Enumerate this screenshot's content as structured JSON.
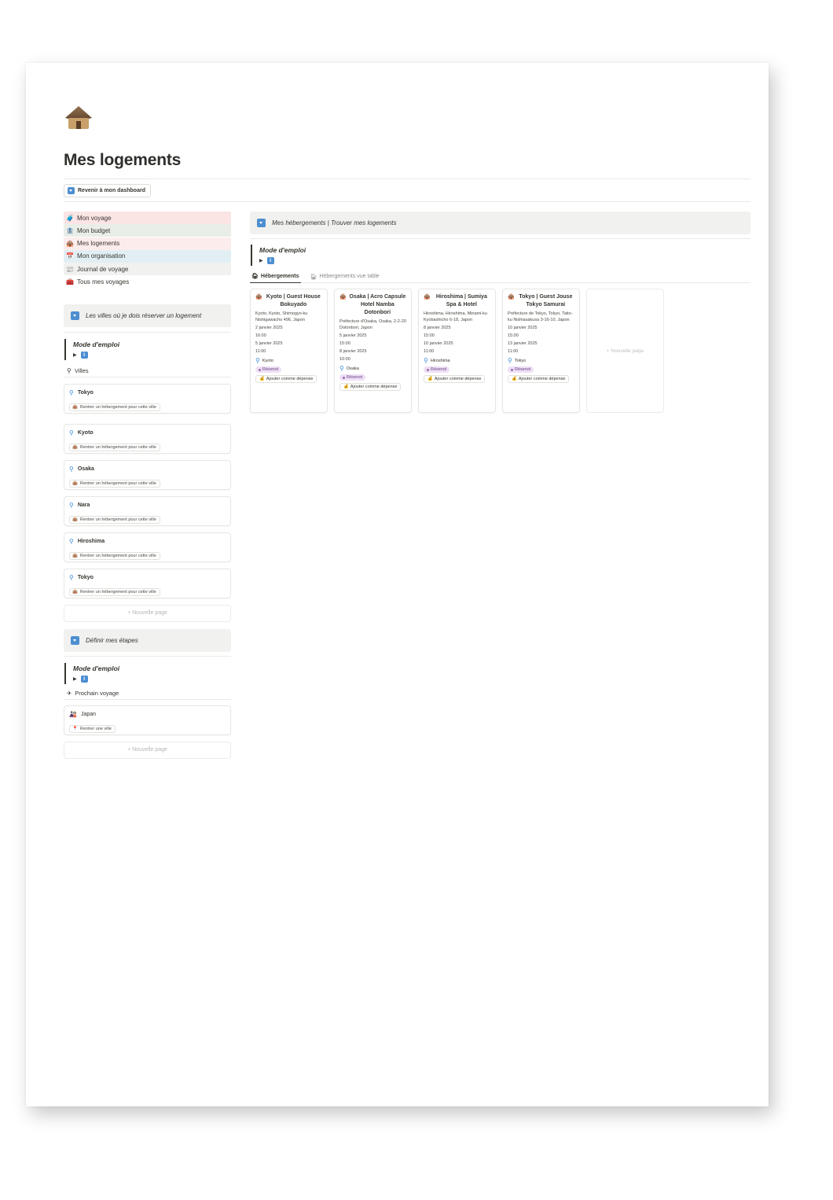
{
  "page": {
    "icon": "hut-icon",
    "title": "Mes logements",
    "back_button": "Revenir à mon dashboard"
  },
  "nav": [
    {
      "label": "Mon voyage",
      "icon": "luggage-icon",
      "emoji": "🧳",
      "bg": "#fbe4e4"
    },
    {
      "label": "Mon budget",
      "icon": "bank-icon",
      "emoji": "🏦",
      "bg": "#eaeee8"
    },
    {
      "label": "Mes logements",
      "icon": "hut-icon",
      "emoji": "🛖",
      "bg": "#fdecec"
    },
    {
      "label": "Mon organisation",
      "icon": "calendar-icon",
      "emoji": "📅",
      "bg": "#e1eff4"
    },
    {
      "label": "Journal de voyage",
      "icon": "newspaper-icon",
      "emoji": "📰",
      "bg": "#f1f1ef"
    },
    {
      "label": "Tous mes voyages",
      "icon": "suitcase-icon",
      "emoji": "🧰",
      "bg": "#ffffff"
    }
  ],
  "cities_section": {
    "callout": "Les villes où je dois réserver un logement",
    "mode_title": "Mode d'emploi",
    "info_glyph": "i",
    "db_title": "Villes",
    "button_label": "Rentrer un hébergement pour cette ville",
    "cities": [
      "Tokyo",
      "Kyoto",
      "Osaka",
      "Nara",
      "Hiroshima",
      "Tokyo"
    ],
    "new_page": "+ Nouvelle page"
  },
  "steps_section": {
    "callout": "Définir mes étapes",
    "mode_title": "Mode d'emploi",
    "info_glyph": "i",
    "db_title": "Prochain voyage",
    "trip_name": "Japan",
    "trip_button": "Rentrer une ville",
    "new_page": "+ Nouvelle page"
  },
  "lodging_section": {
    "callout": "Mes hébergements | Trouver mes logements",
    "mode_title": "Mode d'emploi",
    "info_glyph": "i",
    "tabs": [
      "Hébergements",
      "Hébergements vue table"
    ],
    "status_color": "#eee0f5",
    "cards": [
      {
        "title": "Kyoto | Guest House Bokuyado",
        "address": "Kyoto, Kyoto, Shimogyo-ku Nishigawacho 496, Japon",
        "checkin_date": "2 janvier 2025",
        "checkin_time": "16:00",
        "checkout_date": "5 janvier 2025",
        "checkout_time": "11:00",
        "city": "Kyoto",
        "status": "Réservé",
        "button": "Ajouter comme dépense"
      },
      {
        "title": "Osaka | Acro Capsule Hotel Namba Dotonbori",
        "address": "Préfecture d'Osaka, Osaka, 2-2-20 Dotonbori, Japon",
        "checkin_date": "5 janvier 2025",
        "checkin_time": "15:00",
        "checkout_date": "8 janvier 2025",
        "checkout_time": "10:00",
        "city": "Osaka",
        "status": "Réservé",
        "button": "Ajouter comme dépense"
      },
      {
        "title": "Hiroshima | Sumiya Spa & Hotel",
        "address": "Hiroshima, Hiroshima, Minami-ku Kyobashicho 6-18, Japon",
        "checkin_date": "8 janvier 2025",
        "checkin_time": "15:00",
        "checkout_date": "10 janvier 2025",
        "checkout_time": "11:00",
        "city": "Hiroshima",
        "status": "Réservé",
        "button": "Ajouter comme dépense"
      },
      {
        "title": "Tokyo | Guest Jouse Tokyo Samurai",
        "address": "Préfecture de Tokyo, Tokyo, Taito-ku Nishiasakusa 3-16-10, Japon",
        "checkin_date": "10 janvier 2025",
        "checkin_time": "15:00",
        "checkout_date": "13 janvier 2025",
        "checkout_time": "11:00",
        "city": "Tokyo",
        "status": "Réservé",
        "button": "Ajouter comme dépense"
      }
    ],
    "new_page": "+ Nouvelle page"
  }
}
